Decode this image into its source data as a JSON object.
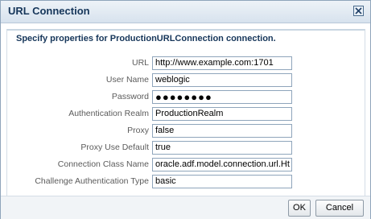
{
  "dialog": {
    "title": "URL Connection",
    "heading": "Specify properties for ProductionURLConnection connection.",
    "close_icon": "close-x-icon"
  },
  "fields": [
    {
      "label": "URL",
      "value": "http://www.example.com:1701"
    },
    {
      "label": "User Name",
      "value": "weblogic"
    },
    {
      "label": "Password",
      "value": "●●●●●●●●"
    },
    {
      "label": "Authentication Realm",
      "value": "ProductionRealm"
    },
    {
      "label": "Proxy",
      "value": "false"
    },
    {
      "label": "Proxy Use Default",
      "value": "true"
    },
    {
      "label": "Connection Class Name",
      "value": "oracle.adf.model.connection.url.Ht"
    },
    {
      "label": "Challenge Authentication Type",
      "value": "basic"
    }
  ],
  "footer": {
    "ok_label": "OK",
    "cancel_label": "Cancel"
  },
  "colors": {
    "title_text": "#16365a",
    "label_text": "#5b5b5b",
    "border": "#8fa5bb"
  }
}
